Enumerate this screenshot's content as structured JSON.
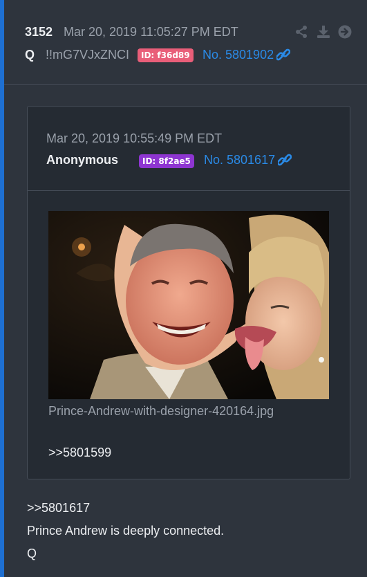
{
  "post": {
    "number": "3152",
    "date": "Mar 20, 2019 11:05:27 PM EDT",
    "author": "Q",
    "tripcode": "!!mG7VJxZNCI",
    "id_badge": "ID: f36d89",
    "post_link": "No. 5801902",
    "actions": [
      "share-icon",
      "download-icon",
      "arrow-right-circle-icon"
    ],
    "body": [
      ">>5801617",
      "Prince Andrew is deeply connected.",
      "Q"
    ]
  },
  "quoted": {
    "date": "Mar 20, 2019 10:55:49 PM EDT",
    "author": "Anonymous",
    "id_badge": "ID: 8f2ae5",
    "post_link": "No. 5801617",
    "image_filename": "Prince-Andrew-with-designer-420164.jpg",
    "reply_ref": ">>5801599"
  },
  "colors": {
    "accent_blue": "#2a8ae6",
    "left_bar": "#1e6fd1",
    "id_red": "#e95e79",
    "id_purple": "#8e35d1"
  }
}
